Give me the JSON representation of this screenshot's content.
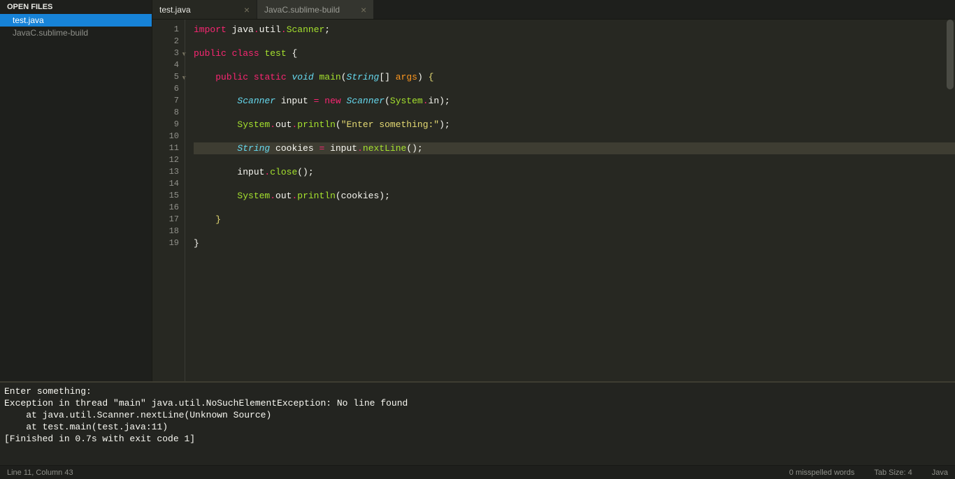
{
  "sidebar": {
    "header": "OPEN FILES",
    "items": [
      {
        "label": "test.java",
        "active": true
      },
      {
        "label": "JavaC.sublime-build",
        "active": false
      }
    ]
  },
  "tabs": [
    {
      "label": "test.java",
      "active": true
    },
    {
      "label": "JavaC.sublime-build",
      "active": false
    }
  ],
  "code": {
    "lines": 19,
    "highlighted_line": 11,
    "fold_lines": [
      3,
      5
    ],
    "dot_lines": [
      5,
      17
    ],
    "content": [
      [
        [
          "kw2",
          "import"
        ],
        [
          "pln",
          " "
        ],
        [
          "pln",
          "java"
        ],
        [
          "op",
          "."
        ],
        [
          "pln",
          "util"
        ],
        [
          "op",
          "."
        ],
        [
          "cls",
          "Scanner"
        ],
        [
          "pln",
          ";"
        ]
      ],
      [],
      [
        [
          "kw2",
          "public"
        ],
        [
          "pln",
          " "
        ],
        [
          "kw2",
          "class"
        ],
        [
          "pln",
          " "
        ],
        [
          "cls",
          "test"
        ],
        [
          "pln",
          " {"
        ]
      ],
      [],
      [
        [
          "pln",
          "    "
        ],
        [
          "kw2",
          "public"
        ],
        [
          "pln",
          " "
        ],
        [
          "kw2",
          "static"
        ],
        [
          "pln",
          " "
        ],
        [
          "kw",
          "void"
        ],
        [
          "pln",
          " "
        ],
        [
          "fn",
          "main"
        ],
        [
          "pln",
          "("
        ],
        [
          "kw",
          "String"
        ],
        [
          "pln",
          "[] "
        ],
        [
          "var",
          "args"
        ],
        [
          "pln",
          ") "
        ],
        [
          "str",
          "{"
        ]
      ],
      [],
      [
        [
          "pln",
          "        "
        ],
        [
          "kw",
          "Scanner"
        ],
        [
          "pln",
          " input "
        ],
        [
          "op",
          "="
        ],
        [
          "pln",
          " "
        ],
        [
          "kw2",
          "new"
        ],
        [
          "pln",
          " "
        ],
        [
          "kw",
          "Scanner"
        ],
        [
          "pln",
          "("
        ],
        [
          "cls",
          "System"
        ],
        [
          "op",
          "."
        ],
        [
          "pln",
          "in);"
        ]
      ],
      [],
      [
        [
          "pln",
          "        "
        ],
        [
          "cls",
          "System"
        ],
        [
          "op",
          "."
        ],
        [
          "pln",
          "out"
        ],
        [
          "op",
          "."
        ],
        [
          "fn",
          "println"
        ],
        [
          "pln",
          "("
        ],
        [
          "str",
          "\"Enter something:\""
        ],
        [
          "pln",
          ");"
        ]
      ],
      [],
      [
        [
          "pln",
          "        "
        ],
        [
          "kw",
          "String"
        ],
        [
          "pln",
          " cookies "
        ],
        [
          "op",
          "="
        ],
        [
          "pln",
          " input"
        ],
        [
          "op",
          "."
        ],
        [
          "fn",
          "nextLine"
        ],
        [
          "pln",
          "();"
        ]
      ],
      [],
      [
        [
          "pln",
          "        input"
        ],
        [
          "op",
          "."
        ],
        [
          "fn",
          "close"
        ],
        [
          "pln",
          "();"
        ]
      ],
      [],
      [
        [
          "pln",
          "        "
        ],
        [
          "cls",
          "System"
        ],
        [
          "op",
          "."
        ],
        [
          "pln",
          "out"
        ],
        [
          "op",
          "."
        ],
        [
          "fn",
          "println"
        ],
        [
          "pln",
          "(cookies);"
        ]
      ],
      [],
      [
        [
          "pln",
          "    "
        ],
        [
          "str",
          "}"
        ]
      ],
      [],
      [
        [
          "pln",
          "}"
        ]
      ]
    ]
  },
  "console": {
    "lines": [
      "Enter something:",
      "Exception in thread \"main\" java.util.NoSuchElementException: No line found",
      "    at java.util.Scanner.nextLine(Unknown Source)",
      "    at test.main(test.java:11)",
      "[Finished in 0.7s with exit code 1]"
    ]
  },
  "status": {
    "left": "Line 11, Column 43",
    "misspelled": "0 misspelled words",
    "tab_size": "Tab Size: 4",
    "language": "Java"
  }
}
